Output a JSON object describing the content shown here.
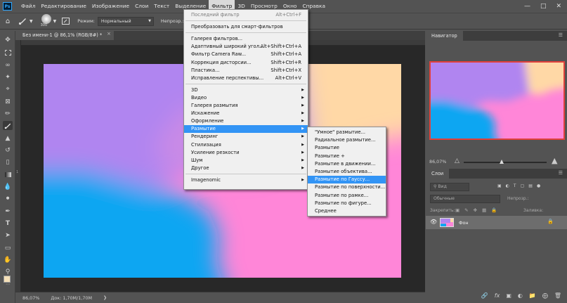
{
  "menubar": {
    "logo": "Ps",
    "items": [
      "Файл",
      "Редактирование",
      "Изображение",
      "Слои",
      "Текст",
      "Выделение",
      "Фильтр",
      "3D",
      "Просмотр",
      "Окно",
      "Справка"
    ],
    "active_index": 6
  },
  "options": {
    "brush_size": "300",
    "mode_label": "Режим:",
    "mode_value": "Нормальный",
    "opacity_label": "Непрозр.:"
  },
  "document": {
    "tab_title": "Без имени-1 @ 86,1% (RGB/8#) *",
    "close": "×"
  },
  "rulers": {
    "v_tick": "1"
  },
  "status": {
    "zoom": "86,07%",
    "doc_info": "Док: 1,70M/1,70M"
  },
  "navigator": {
    "title": "Навигатор",
    "zoom": "86,07%"
  },
  "layers": {
    "title": "Слои",
    "search_placeholder": "Вид",
    "blend_mode": "Обычные",
    "opacity_label": "Непрозр.:",
    "lock_label": "Закрепить:",
    "fill_label": "Заливка:",
    "layer_name": "Фон"
  },
  "filter_menu": {
    "items": [
      {
        "label": "Последний фильтр",
        "shortcut": "Alt+Ctrl+F",
        "disabled": true
      },
      {
        "sep": true
      },
      {
        "label": "Преобразовать для смарт-фильтров",
        "shortcut": ""
      },
      {
        "sep": true
      },
      {
        "label": "Галерея фильтров...",
        "shortcut": ""
      },
      {
        "label": "Адаптивный широкий угол...",
        "shortcut": "Alt+Shift+Ctrl+A"
      },
      {
        "label": "Фильтр Camera Raw...",
        "shortcut": "Shift+Ctrl+A"
      },
      {
        "label": "Коррекция дисторсии...",
        "shortcut": "Shift+Ctrl+R"
      },
      {
        "label": "Пластика...",
        "shortcut": "Shift+Ctrl+X"
      },
      {
        "label": "Исправление перспективы...",
        "shortcut": "Alt+Ctrl+V"
      },
      {
        "sep": true
      },
      {
        "label": "3D",
        "submenu": true
      },
      {
        "label": "Видео",
        "submenu": true
      },
      {
        "label": "Галерея размытия",
        "submenu": true
      },
      {
        "label": "Искажение",
        "submenu": true
      },
      {
        "label": "Оформление",
        "submenu": true
      },
      {
        "label": "Размытие",
        "submenu": true,
        "highlight": true
      },
      {
        "label": "Рендеринг",
        "submenu": true
      },
      {
        "label": "Стилизация",
        "submenu": true
      },
      {
        "label": "Усиление резкости",
        "submenu": true
      },
      {
        "label": "Шум",
        "submenu": true
      },
      {
        "label": "Другое",
        "submenu": true
      },
      {
        "sep": true
      },
      {
        "label": "Imagenomic",
        "submenu": true
      }
    ]
  },
  "blur_submenu": {
    "items": [
      {
        "label": "\"Умное\" размытие..."
      },
      {
        "label": "Радиальное размытие..."
      },
      {
        "label": "Размытие"
      },
      {
        "label": "Размытие +"
      },
      {
        "label": "Размытие в движении..."
      },
      {
        "label": "Размытие объектива..."
      },
      {
        "label": "Размытие по Гауссу...",
        "highlight": true
      },
      {
        "label": "Размытие по поверхности..."
      },
      {
        "label": "Размытие по рамке..."
      },
      {
        "label": "Размытие по фигуре..."
      },
      {
        "label": "Среднее"
      }
    ]
  },
  "icons": {
    "brush": "brush-icon",
    "move": "move-icon",
    "eye": "eye-icon",
    "lock": "lock-icon"
  },
  "colors": {
    "menu_highlight": "#3294f5",
    "foreground_swatch": "#f5e0b8"
  }
}
